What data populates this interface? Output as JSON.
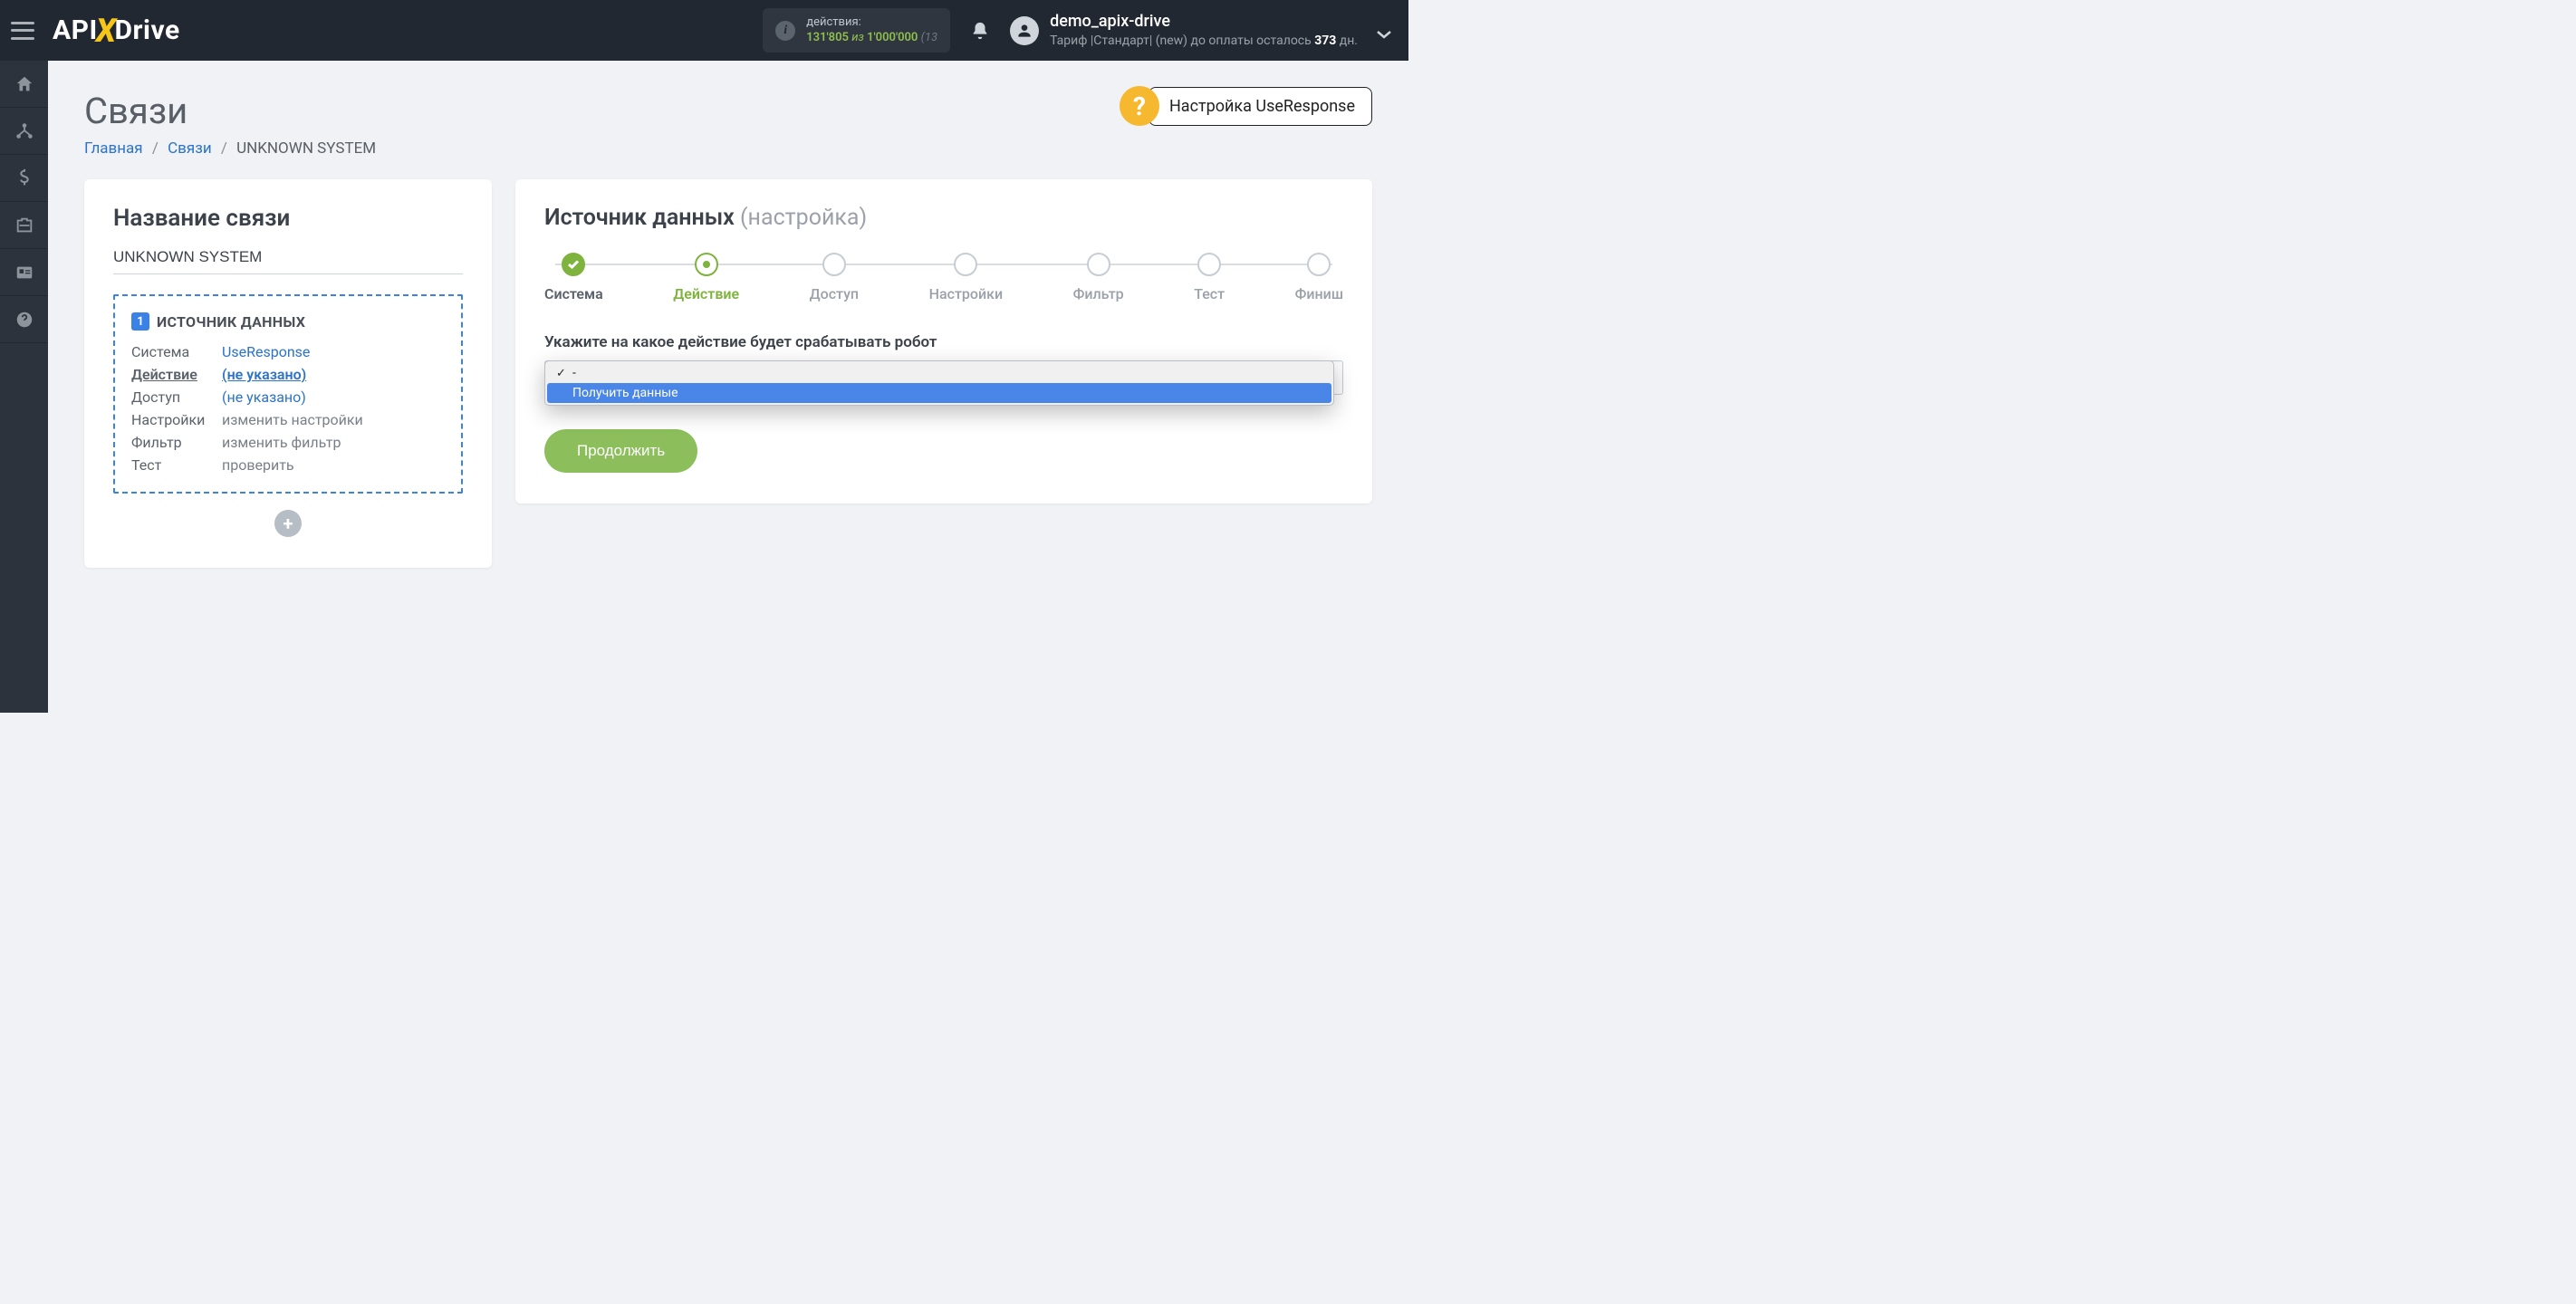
{
  "header": {
    "actions_label": "действия:",
    "actions_used": "131'805",
    "actions_of": "из",
    "actions_total": "1'000'000",
    "actions_pct_trunc": "(13",
    "user_name": "demo_apix-drive",
    "tariff_prefix": "Тариф |Стандарт| (new) до оплаты осталось ",
    "tariff_days": "373",
    "tariff_suffix": " дн."
  },
  "page": {
    "title": "Связи",
    "breadcrumb": {
      "home": "Главная",
      "links": "Связи",
      "current": "UNKNOWN SYSTEM"
    },
    "help_label": "Настройка UseResponse"
  },
  "left_card": {
    "title": "Название связи",
    "connection_name": "UNKNOWN SYSTEM",
    "box_number": "1",
    "box_title": "ИСТОЧНИК ДАННЫХ",
    "rows": {
      "system_label": "Система",
      "system_value": "UseResponse",
      "action_label": "Действие",
      "action_value": "(не указано)",
      "access_label": "Доступ",
      "access_value": "(не указано)",
      "settings_label": "Настройки",
      "settings_value": "изменить настройки",
      "filter_label": "Фильтр",
      "filter_value": "изменить фильтр",
      "test_label": "Тест",
      "test_value": "проверить"
    }
  },
  "right_card": {
    "title": "Источник данных",
    "title_sub": "(настройка)",
    "steps": [
      "Система",
      "Действие",
      "Доступ",
      "Настройки",
      "Фильтр",
      "Тест",
      "Финиш"
    ],
    "form_label": "Укажите на какое действие будет срабатывать робот",
    "select_value": "-",
    "dropdown_options": [
      {
        "label": "-",
        "checked": true
      },
      {
        "label": "Получить данные",
        "highlight": true
      }
    ],
    "continue_button": "Продолжить"
  }
}
